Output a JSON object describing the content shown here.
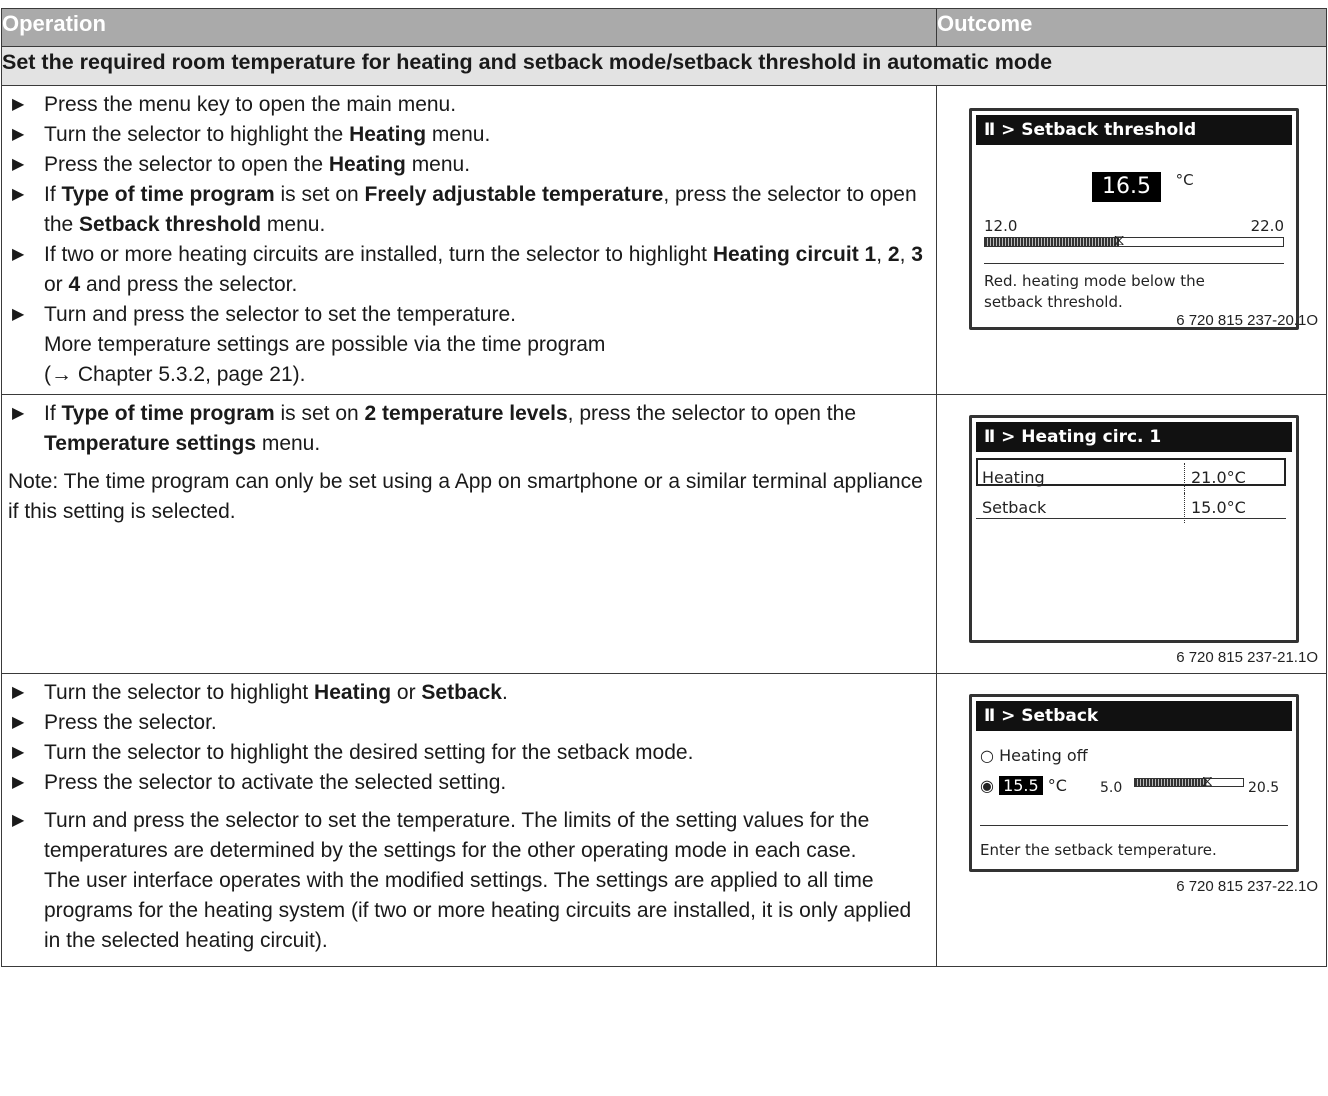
{
  "header": {
    "col_operation": "Operation",
    "col_outcome": "Outcome"
  },
  "section_title": "Set the required room temperature for heating and setback mode/setback threshold in automatic mode",
  "rows": [
    {
      "steps": [
        "Press the menu key to open the main menu.",
        [
          "Turn the selector to highlight the ",
          {
            "b": "Heating"
          },
          " menu."
        ],
        [
          "Press the selector to open the ",
          {
            "b": "Heating"
          },
          " menu."
        ],
        [
          "If ",
          {
            "b": "Type of time program"
          },
          " is set on ",
          {
            "b": "Freely adjustable temperature"
          },
          ", press the selector to open the ",
          {
            "b": "Setback threshold"
          },
          " menu."
        ],
        [
          "If two or more heating circuits are installed, turn the selector to highlight ",
          {
            "b": "Heating circuit 1"
          },
          ", ",
          {
            "b": "2"
          },
          ", ",
          {
            "b": "3"
          },
          " or ",
          {
            "b": "4"
          },
          " and press the selector."
        ],
        [
          "Turn and press the selector to set the temperature.",
          {
            "br": true
          },
          "More temperature settings are possible via the time program",
          {
            "br": true
          },
          "(→ Chapter 5.3.2, page 21)."
        ]
      ]
    },
    {
      "steps": [
        [
          "If ",
          {
            "b": "Type of time program"
          },
          " is set on ",
          {
            "b": "2 temperature levels"
          },
          ", press the selector to open the ",
          {
            "b": "Temperature settings"
          },
          " menu."
        ]
      ],
      "note": "Note: The time program can only be set using a App on smartphone or a similar terminal appliance if this setting is selected."
    },
    {
      "steps": [
        [
          "Turn the selector to highlight ",
          {
            "b": "Heating"
          },
          " or ",
          {
            "b": "Setback"
          },
          "."
        ],
        "Press the selector.",
        "Turn the selector to highlight the desired setting for the setback mode.",
        "Press the selector to activate the selected setting.",
        [
          "Turn and press the selector to set the temperature. The limits of the setting values for the temperatures are determined by the settings for the other operating mode in each case.",
          {
            "br": true
          },
          "The user interface operates with the modified settings. The settings are applied to all time programs for the heating system (if two or more heating circuits are installed, it is only applied in the selected heating circuit)."
        ]
      ]
    }
  ],
  "screens": {
    "s1": {
      "title": "░ > Setback threshold",
      "menu_icon": "radiator-icon",
      "crumb": "> Setback threshold",
      "value": "16.5",
      "unit": "°C",
      "min": "12.0",
      "max": "22.0",
      "level": 0.45,
      "text": "Red. heating mode below the setback threshold.",
      "figno": "6 720 815 237-20.1O"
    },
    "s2": {
      "crumb": "> Heating circ. 1",
      "menu_icon": "radiator-icon",
      "row1_label": "Heating",
      "row1_value": "21.0°C",
      "row2_label": "Setback",
      "row2_value": "15.0°C",
      "figno": "6 720 815 237-21.1O"
    },
    "s3": {
      "crumb": "> Setback",
      "menu_icon": "radiator-icon",
      "option1": "Heating off",
      "value": "15.5",
      "unit": "°C",
      "min": "5.0",
      "max": "20.5",
      "level": 0.67,
      "text": "Enter the setback temperature.",
      "figno": "6 720 815 237-22.1O"
    }
  }
}
